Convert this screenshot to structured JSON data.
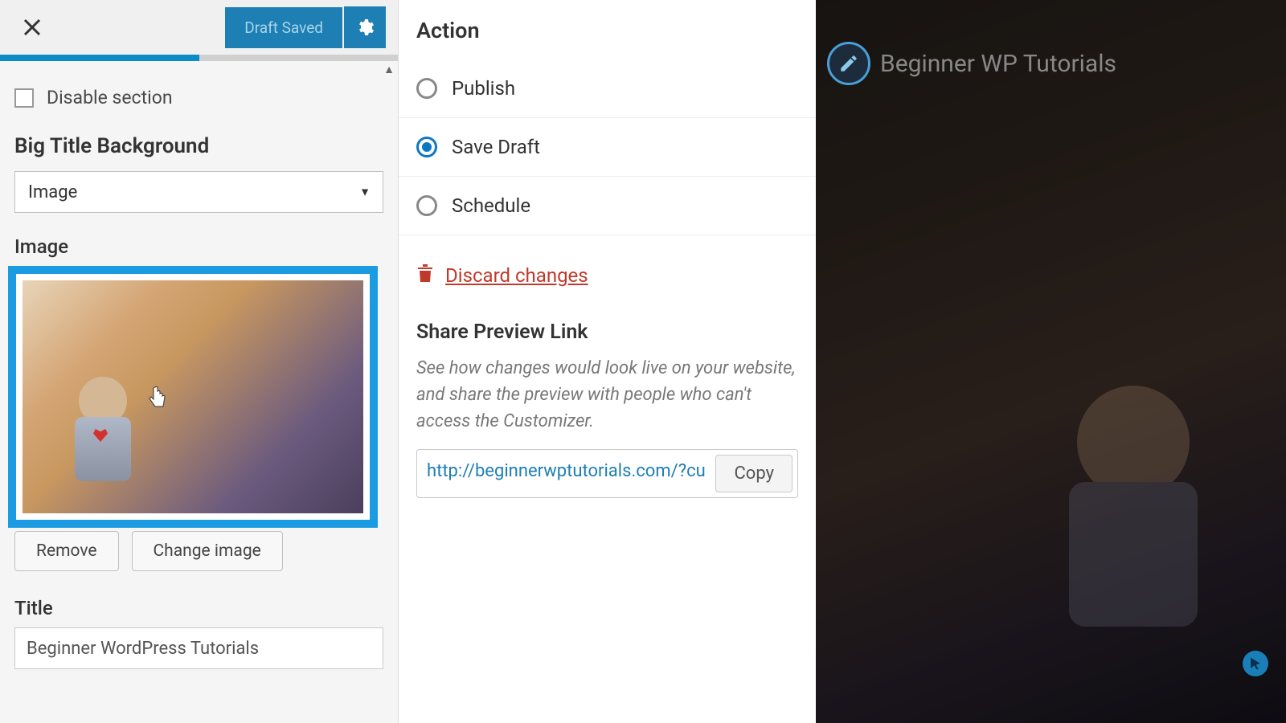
{
  "leftPanel": {
    "draftSavedLabel": "Draft Saved",
    "disableSection": "Disable section",
    "bigTitleBgHeading": "Big Title Background",
    "bgTypeSelected": "Image",
    "imageLabel": "Image",
    "removeBtn": "Remove",
    "changeImageBtn": "Change image",
    "titleLabel": "Title",
    "titleValue": "Beginner WordPress Tutorials"
  },
  "middlePanel": {
    "actionHeading": "Action",
    "options": {
      "publish": "Publish",
      "saveDraft": "Save Draft",
      "schedule": "Schedule"
    },
    "discard": "Discard changes",
    "shareHeading": "Share Preview Link",
    "shareDesc": "See how changes would look live on your website, and share the preview with people who can't access the Customizer.",
    "shareUrl": "http://beginnerwptutorials.com/?cu",
    "copyBtn": "Copy"
  },
  "preview": {
    "siteTitle": "Beginner WP Tutorials"
  }
}
